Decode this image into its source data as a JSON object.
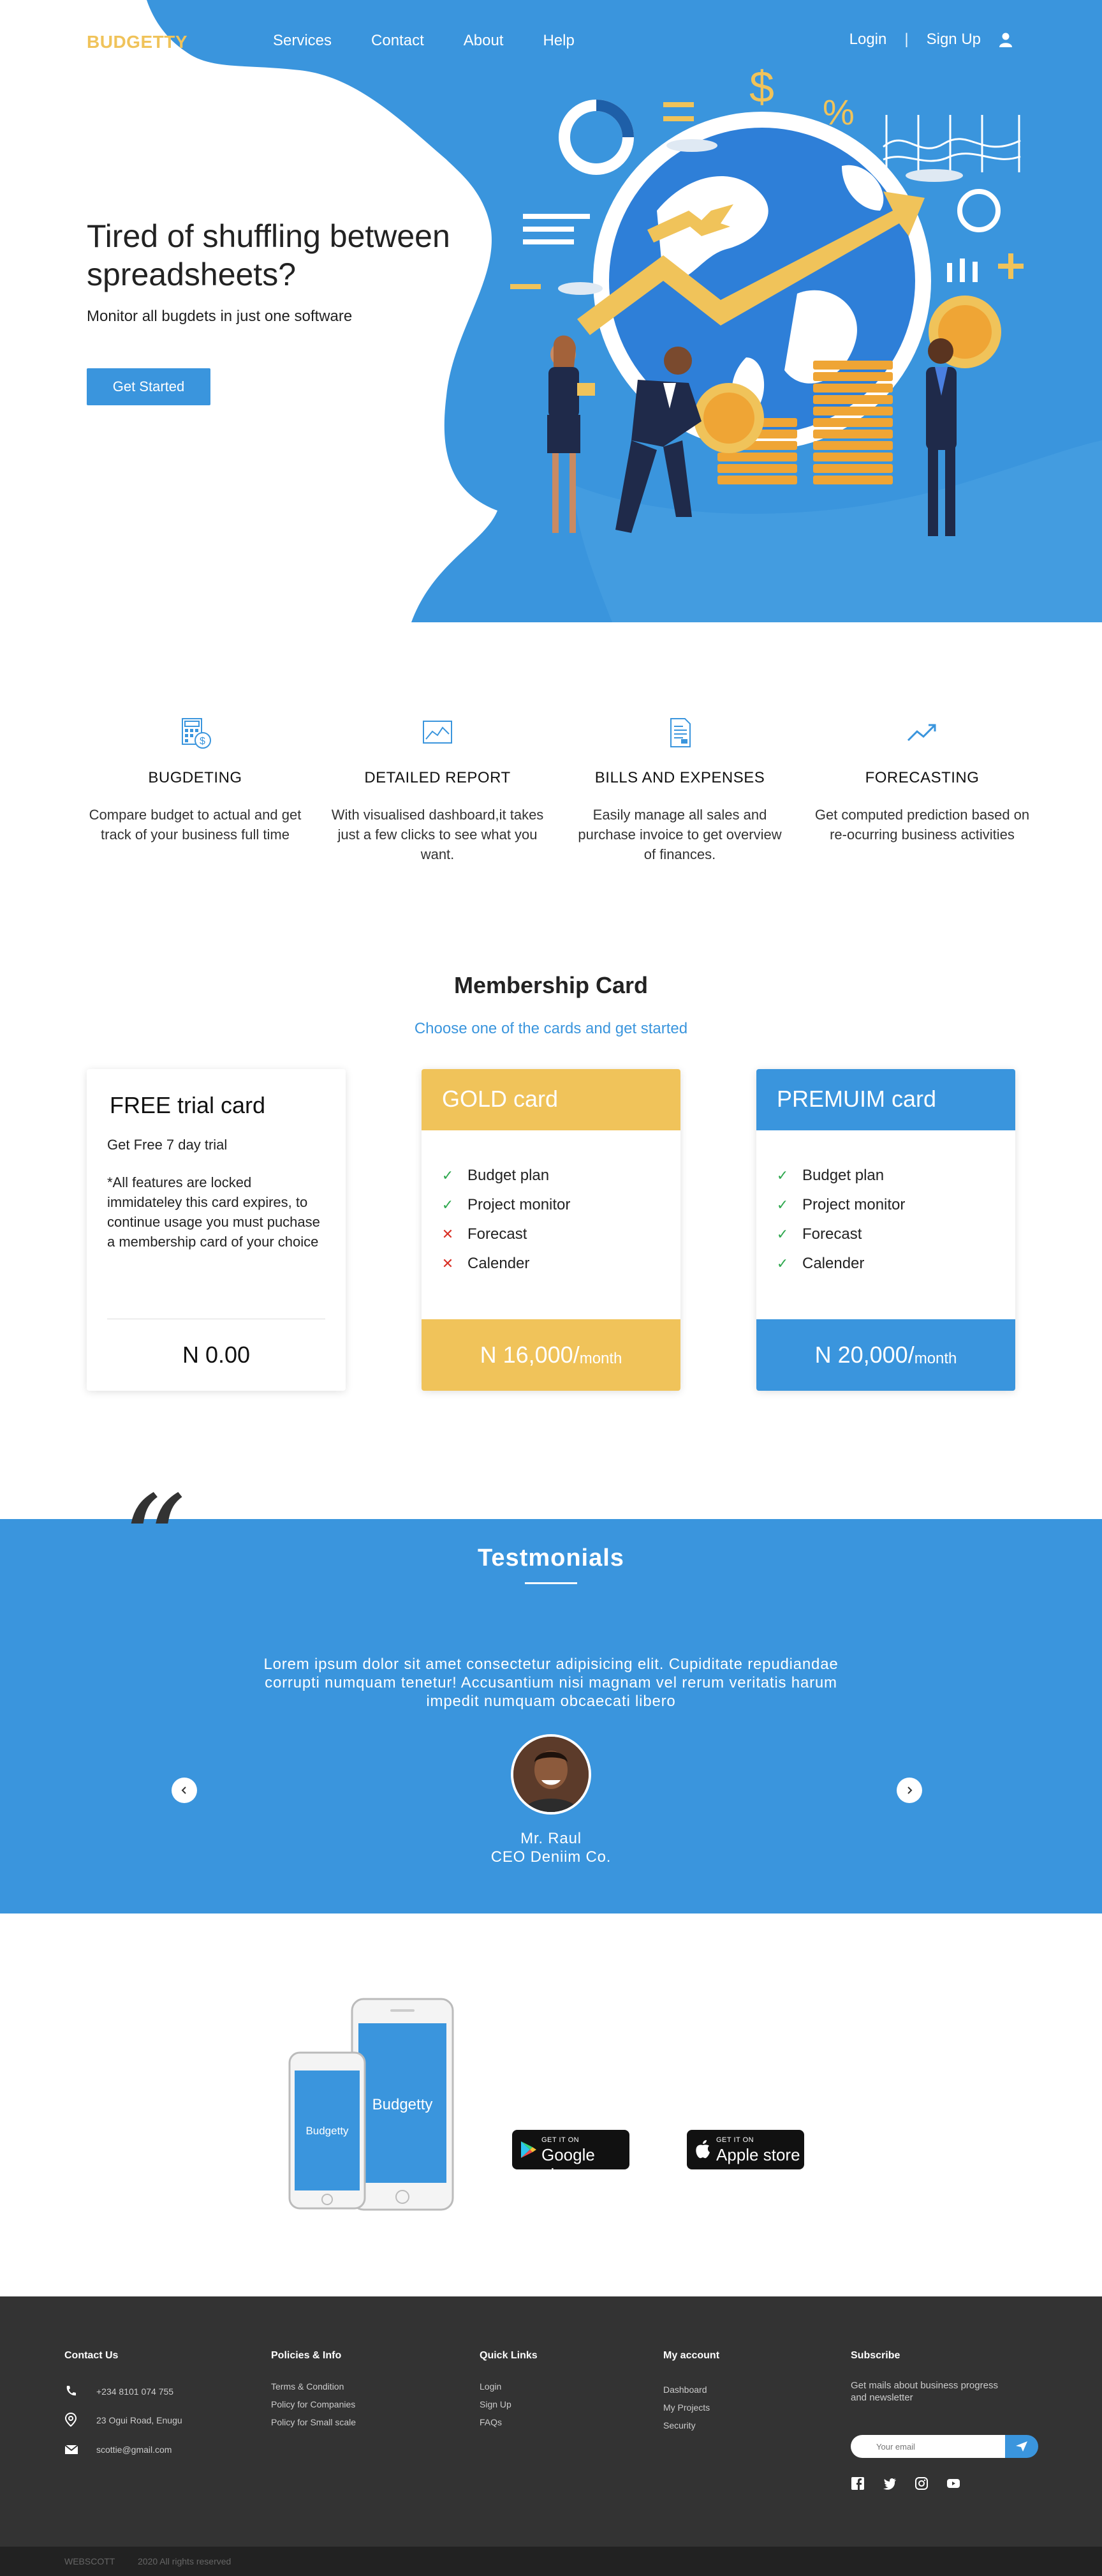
{
  "brand": {
    "name": "BUDGETTY",
    "accent": "#F0C35A",
    "primary": "#3A95DD"
  },
  "nav": {
    "items": [
      "Services",
      "Contact",
      "About",
      "Help"
    ],
    "login": "Login",
    "separator": "|",
    "signup": "Sign Up"
  },
  "hero": {
    "title": "Tired of shuffling between spreadsheets?",
    "subtitle": "Monitor all bugdets in just one software",
    "cta": "Get Started"
  },
  "features": [
    {
      "icon": "budget-calculator-icon",
      "title": "BUGDETING",
      "text": "Compare budget\nto actual and get track of your business full time"
    },
    {
      "icon": "report-chart-icon",
      "title": "DETAILED REPORT",
      "text": "With visualised dashboard,it takes just a few clicks to see what you want."
    },
    {
      "icon": "invoice-document-icon",
      "title": "BILLS AND EXPENSES",
      "text": "Easily manage all sales and purchase invoice to get overview of finances."
    },
    {
      "icon": "trend-up-icon",
      "title": "FORECASTING",
      "text": "Get computed prediction based on re-ocurring business activities"
    }
  ],
  "membership": {
    "title": "Membership Card",
    "subtitle": "Choose one of the cards and get started",
    "free": {
      "title": "FREE trial card",
      "line1": "Get Free 7 day trial",
      "line2": "*All features are locked immidateley this card expires, to continue usage you must puchase a membership card of your choice",
      "price": "N 0.00"
    },
    "gold": {
      "title": "GOLD card",
      "color": "#F0C35A",
      "features": [
        {
          "label": "Budget plan",
          "included": true
        },
        {
          "label": "Project monitor",
          "included": true
        },
        {
          "label": "Forecast",
          "included": false
        },
        {
          "label": "Calender",
          "included": false
        }
      ],
      "price": "N 16,000/",
      "per": "month"
    },
    "premium": {
      "title": "PREMUIM card",
      "color": "#3A95DD",
      "features": [
        {
          "label": "Budget plan",
          "included": true
        },
        {
          "label": "Project monitor",
          "included": true
        },
        {
          "label": "Forecast",
          "included": true
        },
        {
          "label": "Calender",
          "included": true
        }
      ],
      "price": "N 20,000/",
      "per": "month"
    }
  },
  "testimonials": {
    "title": "Testmonials",
    "quote_glyph": "“",
    "text": "Lorem ipsum dolor sit amet consectetur adipisicing elit. Cupiditate repudiandae corrupti numquam tenetur! Accusantium nisi magnam vel rerum veritatis harum impedit numquam obcaecati libero",
    "name": "Mr. Raul",
    "role": "CEO Deniim Co."
  },
  "app": {
    "phone_label": "Budgetty",
    "google": {
      "small": "GET IT ON",
      "big": "Google play"
    },
    "apple": {
      "small": "GET IT ON",
      "big": "Apple store"
    }
  },
  "footer": {
    "contact": {
      "title": "Contact Us",
      "phone": "+234 8101 074 755",
      "address": "23 Ogui Road, Enugu",
      "email": "scottie@gmail.com"
    },
    "policies": {
      "title": "Policies & Info",
      "links": [
        "Terms & Condition",
        "Policy for Companies",
        "Policy for Small scale"
      ]
    },
    "quick": {
      "title": "Quick Links",
      "links": [
        "Login",
        "Sign Up",
        "FAQs"
      ]
    },
    "account": {
      "title": "My account",
      "links": [
        "Dashboard",
        "My Projects",
        "Security"
      ]
    },
    "subscribe": {
      "title": "Subscribe",
      "text": "Get mails about business progress and newsletter",
      "placeholder": "Your email"
    },
    "copyright_brand": "WEBSCOTT",
    "copyright_text": "2020 All rights reserved"
  }
}
